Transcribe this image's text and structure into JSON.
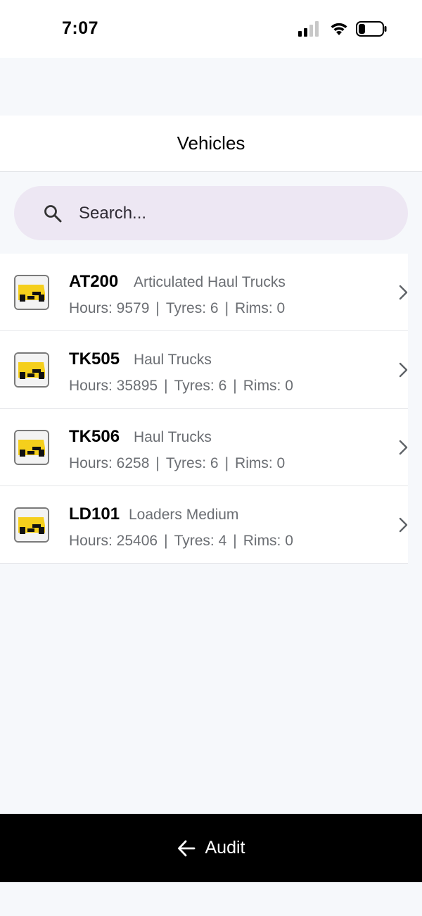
{
  "status_bar": {
    "time": "7:07",
    "icons": [
      "cellular-signal-icon",
      "wifi-icon",
      "battery-icon"
    ]
  },
  "header": {
    "title": "Vehicles"
  },
  "search": {
    "placeholder": "Search...",
    "value": "",
    "icon": "search-icon"
  },
  "vehicles": [
    {
      "id": "AT200",
      "type": "Articulated Haul Trucks",
      "hours": "Hours: 9579",
      "tyres": "Tyres: 6",
      "rims": "Rims: 0"
    },
    {
      "id": "TK505",
      "type": "Haul Trucks",
      "hours": "Hours: 35895",
      "tyres": "Tyres: 6",
      "rims": "Rims: 0"
    },
    {
      "id": "TK506",
      "type": "Haul Trucks",
      "hours": "Hours: 6258",
      "tyres": "Tyres: 6",
      "rims": "Rims: 0"
    },
    {
      "id": "LD101",
      "type": "Loaders Medium",
      "hours": "Hours: 25406",
      "tyres": "Tyres: 4",
      "rims": "Rims: 0"
    }
  ],
  "separator": "|",
  "bottom_bar": {
    "label": "Audit",
    "icon": "back-arrow-icon"
  },
  "colors": {
    "search_bg": "#ede7f3",
    "vehicle_icon_yellow": "#f5cf1c",
    "secondary_text": "#6b6e73",
    "bottom_bar_bg": "#000000"
  }
}
